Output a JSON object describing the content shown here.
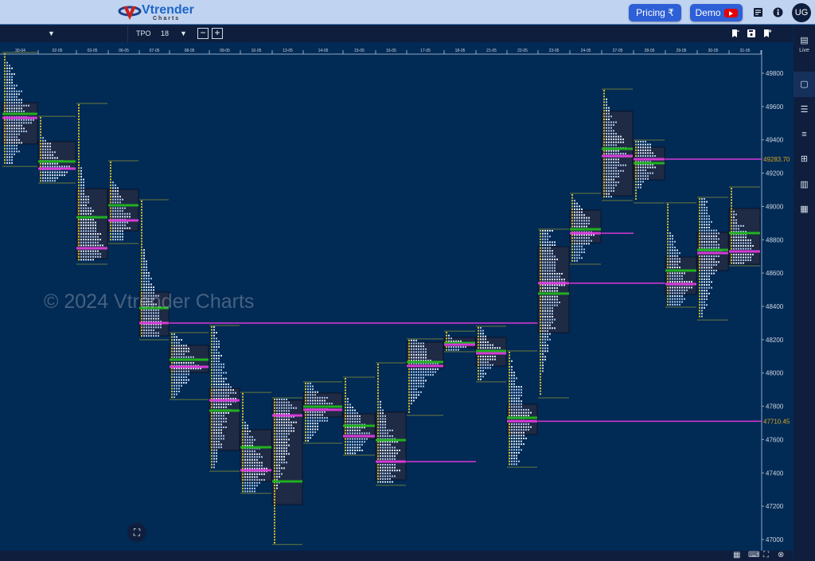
{
  "header": {
    "brand": "Vtrender",
    "brand_sub": "Charts",
    "pricing_label": "Pricing ₹",
    "demo_label": "Demo",
    "avatar": "UG",
    "icons": [
      "notes-icon",
      "info-icon"
    ]
  },
  "toolbar": {
    "chart_type": "TPO",
    "tpo_size": "18",
    "icons": [
      "bookmark-remove-icon",
      "save-icon",
      "bookmark-add-icon"
    ]
  },
  "sidebar": {
    "live_label": "Live",
    "items": [
      "single-layout-icon",
      "split-layout-icon",
      "rows-layout-icon",
      "grid-layout-icon",
      "columns-layout-icon",
      "grid6-layout-icon"
    ]
  },
  "watermark": "© 2024 Vtrender Charts",
  "colors": {
    "background": "#012a55",
    "poc": "#d63ad6",
    "vwap": "#20b020",
    "value_area_box": "#1f2a45",
    "accent": "#2d5fd6",
    "price_label": "#d9a520"
  },
  "chart_data": {
    "type": "tpo-profile",
    "ylim": [
      47000,
      49800
    ],
    "y_ticks": [
      47000,
      47200,
      47400,
      47600,
      47800,
      48000,
      48200,
      48400,
      48600,
      48800,
      49000,
      49200,
      49400,
      49600,
      49800
    ],
    "price_labels": [
      "49283.70",
      "47710.45"
    ],
    "days": [
      {
        "date": "30-04",
        "high": 49915,
        "low": 49250,
        "vah": 49623,
        "val": 49375,
        "poc": 49532,
        "vwap": 49556
      },
      {
        "date": "02-05",
        "high": 49532,
        "low": 49150,
        "vah": 49389,
        "val": 49227,
        "poc": 49227,
        "vwap": 49270
      },
      {
        "date": "03-05",
        "high": 49609,
        "low": 48663,
        "vah": 49107,
        "val": 48687,
        "poc": 48749,
        "vwap": 48935
      },
      {
        "date": "06-05",
        "high": 49265,
        "low": 48787,
        "vah": 49102,
        "val": 48854,
        "poc": 48916,
        "vwap": 49007
      },
      {
        "date": "07-05",
        "high": 49031,
        "low": 48209,
        "vah": 48486,
        "val": 48223,
        "poc": 48300,
        "vwap": 48390
      },
      {
        "date": "08-05",
        "high": 48233,
        "low": 47850,
        "vah": 48166,
        "val": 48003,
        "poc": 48037,
        "vwap": 48080
      },
      {
        "date": "09-05",
        "high": 48276,
        "low": 47420,
        "vah": 47908,
        "val": 47535,
        "poc": 47836,
        "vwap": 47774
      },
      {
        "date": "10-05",
        "high": 47874,
        "low": 47287,
        "vah": 47659,
        "val": 47349,
        "poc": 47416,
        "vwap": 47554
      },
      {
        "date": "13-05",
        "high": 47841,
        "low": 46980,
        "vah": 47836,
        "val": 47210,
        "poc": 47745,
        "vwap": 47349
      },
      {
        "date": "14-05",
        "high": 47937,
        "low": 47588,
        "vah": 47880,
        "val": 47736,
        "poc": 47779,
        "vwap": 47798
      },
      {
        "date": "15-05",
        "high": 47965,
        "low": 47516,
        "vah": 47755,
        "val": 47602,
        "poc": 47621,
        "vwap": 47683
      },
      {
        "date": "16-05",
        "high": 48051,
        "low": 47335,
        "vah": 47765,
        "val": 47358,
        "poc": 47468,
        "vwap": 47597
      },
      {
        "date": "17-05",
        "high": 48195,
        "low": 47755,
        "vah": 48185,
        "val": 48032,
        "poc": 48042,
        "vwap": 48066
      },
      {
        "date": "18-05",
        "high": 48242,
        "low": 48137,
        "vah": 48214,
        "val": 48152,
        "poc": 48170,
        "vwap": 48180
      },
      {
        "date": "21-05",
        "high": 48271,
        "low": 47956,
        "vah": 48214,
        "val": 48042,
        "poc": 48118,
        "vwap": 48132
      },
      {
        "date": "22-05",
        "high": 48123,
        "low": 47444,
        "vah": 47812,
        "val": 47631,
        "poc": 47710.45,
        "vwap": 47731
      },
      {
        "date": "23-05",
        "high": 48854,
        "low": 47860,
        "vah": 48758,
        "val": 48242,
        "poc": 48539,
        "vwap": 48477
      },
      {
        "date": "24-05",
        "high": 49069,
        "low": 48663,
        "vah": 48978,
        "val": 48782,
        "poc": 48839,
        "vwap": 48863
      },
      {
        "date": "27-05",
        "high": 49695,
        "low": 49045,
        "vah": 49571,
        "val": 49064,
        "poc": 49303,
        "vwap": 49346
      },
      {
        "date": "28-05",
        "high": 49389,
        "low": 49031,
        "vah": 49356,
        "val": 49160,
        "poc": 49283.7,
        "vwap": 49260
      },
      {
        "date": "29-05",
        "high": 49012,
        "low": 48405,
        "vah": 48696,
        "val": 48472,
        "poc": 48534,
        "vwap": 48615
      },
      {
        "date": "30-05",
        "high": 49045,
        "low": 48328,
        "vah": 48844,
        "val": 48615,
        "poc": 48720,
        "vwap": 48739
      },
      {
        "date": "31-05",
        "high": 49107,
        "low": 48653,
        "vah": 48988,
        "val": 48653,
        "poc": 48730,
        "vwap": 48840
      }
    ],
    "naked_pocs": [
      {
        "from": "07-05",
        "to": "23-05",
        "price": 48300
      },
      {
        "from": "16-05",
        "to": "21-05",
        "price": 47468
      },
      {
        "from": "22-05",
        "to": "end",
        "price": 47710.45
      },
      {
        "from": "23-05",
        "to": "29-05",
        "price": 48539
      },
      {
        "from": "24-05",
        "to": "28-05",
        "price": 48839
      },
      {
        "from": "28-05",
        "to": "end",
        "price": 49283.7
      }
    ]
  }
}
